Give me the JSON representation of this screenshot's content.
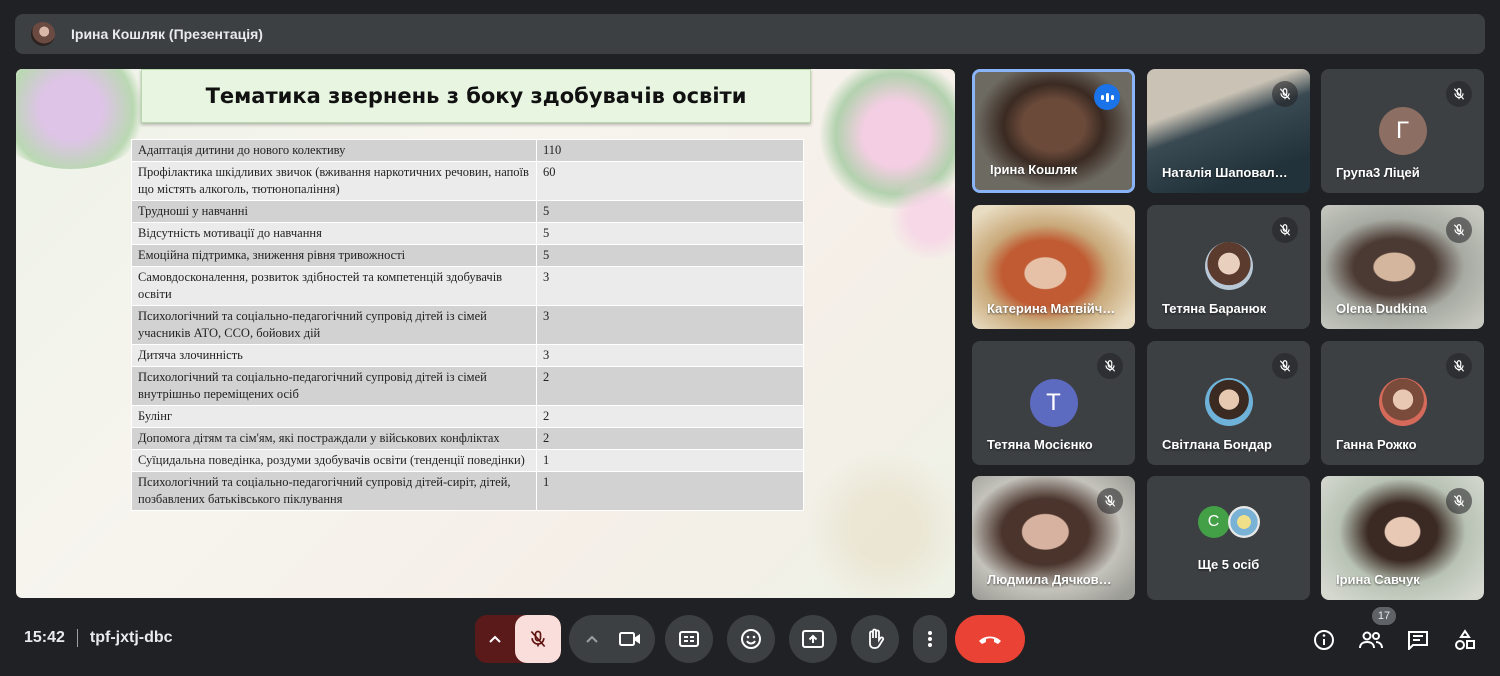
{
  "presenter_bar": {
    "title": "Ірина Кошляк (Презентація)"
  },
  "slide": {
    "title": "Тематика звернень з боку здобувачів освіти",
    "rows": [
      {
        "topic": "Адаптація дитини до нового колективу",
        "count": "110"
      },
      {
        "topic": "Профілактика шкідливих звичок (вживання наркотичних речовин, напоїв що містять алкоголь, тютюнопаління)",
        "count": "60"
      },
      {
        "topic": "Трудноші у навчанні",
        "count": "5"
      },
      {
        "topic": "Відсутність мотивації до навчання",
        "count": "5"
      },
      {
        "topic": "Емоційна підтримка, зниження рівня тривожності",
        "count": "5"
      },
      {
        "topic": "Самовдосконалення, розвиток здібностей та компетенцій здобувачів освіти",
        "count": "3"
      },
      {
        "topic": "Психологічний та соціально-педагогічний супровід дітей із сімей учасників АТО, ССО, бойових дій",
        "count": "3"
      },
      {
        "topic": "Дитяча злочинність",
        "count": "3"
      },
      {
        "topic": "Психологічний та соціально-педагогічний супровід дітей із сімей внутрішньо переміщених осіб",
        "count": "2"
      },
      {
        "topic": "Булінг",
        "count": "2"
      },
      {
        "topic": "Допомога дітям та сім'ям, які постраждали у військових конфліктах",
        "count": "2"
      },
      {
        "topic": "Суїцидальна поведінка, роздуми здобувачів освіти (тенденції поведінки)",
        "count": "1"
      },
      {
        "topic": "Психологічний та соціально-педагогічний супровід дітей-сиріт, дітей, позбавлених батьківського піклування",
        "count": "1"
      }
    ]
  },
  "participants": [
    {
      "name": "Ірина Кошляк",
      "state": "speaking"
    },
    {
      "name": "Наталія Шаповал…",
      "state": "muted"
    },
    {
      "name": "Група3 Ліцей",
      "state": "muted",
      "letter": "Г",
      "color": "#8d6e63"
    },
    {
      "name": "Катерина Матвійч…",
      "state": "video"
    },
    {
      "name": "Тетяна Баранюк",
      "state": "muted"
    },
    {
      "name": "Olena Dudkina",
      "state": "muted"
    },
    {
      "name": "Тетяна Мосієнко",
      "state": "muted",
      "letter": "Т",
      "color": "#5c6bc0"
    },
    {
      "name": "Світлана Бондар",
      "state": "muted"
    },
    {
      "name": "Ганна Рожко",
      "state": "muted"
    },
    {
      "name": "Людмила Дячков…",
      "state": "muted"
    },
    {
      "name": "Ще 5 осіб",
      "state": "more",
      "letter": "С",
      "color": "#43a047"
    },
    {
      "name": "Ірина Савчук",
      "state": "muted"
    }
  ],
  "footer": {
    "time": "15:42",
    "meeting_code": "tpf-jxtj-dbc",
    "participant_count": "17"
  }
}
